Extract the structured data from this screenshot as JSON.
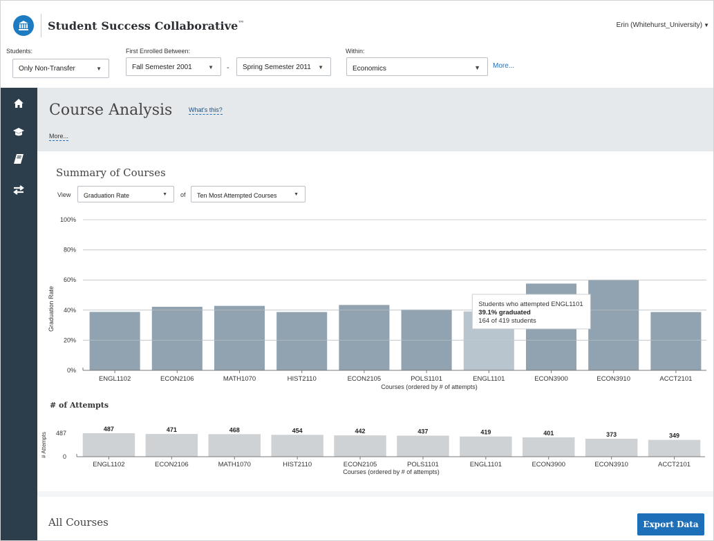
{
  "app": {
    "title": "Student Success Collaborative",
    "trademark": "™",
    "user": "Erin (Whitehurst_University)",
    "logo_icon": "university-building-icon"
  },
  "filters": {
    "students_label": "Students:",
    "students_value": "Only Non-Transfer",
    "enrolled_label": "First Enrolled Between:",
    "enrolled_from": "Fall Semester 2001",
    "enrolled_sep": "-",
    "enrolled_to": "Spring Semester 2011",
    "within_label": "Within:",
    "within_value": "Economics",
    "more_label": "More..."
  },
  "sidebar": {
    "items": [
      {
        "icon": "home-icon"
      },
      {
        "icon": "graduation-cap-icon"
      },
      {
        "icon": "book-icon"
      },
      {
        "icon": "transfer-arrows-icon"
      }
    ]
  },
  "page": {
    "title": "Course Analysis",
    "whats_this": "What's this?",
    "more": "More..."
  },
  "summary": {
    "title": "Summary of Courses",
    "view_label": "View",
    "view_value": "Graduation Rate",
    "of_label": "of",
    "of_value": "Ten Most Attempted Courses"
  },
  "chart_data": [
    {
      "type": "bar",
      "categories": [
        "ENGL1102",
        "ECON2106",
        "MATH1070",
        "HIST2110",
        "ECON2105",
        "POLS1101",
        "ENGL1101",
        "ECON3900",
        "ECON3910",
        "ACCT2101"
      ],
      "values": [
        38.8,
        42.2,
        42.8,
        38.7,
        43.4,
        40.3,
        39.1,
        57.6,
        60.0,
        38.7
      ],
      "ylabel": "Graduation Rate",
      "xlabel": "Courses (ordered by # of attempts)",
      "yticks": [
        "0%",
        "20%",
        "40%",
        "60%",
        "80%",
        "100%"
      ],
      "ylim": [
        0,
        100
      ],
      "grid": true,
      "highlight_index": 6,
      "tooltip": {
        "line1": "Students who attempted ENGL1101",
        "line2": "39.1% graduated",
        "line3": "164 of 419 students"
      },
      "colors": {
        "bar": "#91a3b0",
        "highlight": "#b8c5ce"
      }
    },
    {
      "type": "bar",
      "title": "# of Attempts",
      "categories": [
        "ENGL1102",
        "ECON2106",
        "MATH1070",
        "HIST2110",
        "ECON2105",
        "POLS1101",
        "ENGL1101",
        "ECON3900",
        "ECON3910",
        "ACCT2101"
      ],
      "values": [
        487,
        471,
        468,
        454,
        442,
        437,
        419,
        401,
        373,
        349
      ],
      "ylabel": "# Attempts",
      "xlabel": "Courses (ordered by # of attempts)",
      "yticks": [
        "0",
        "487"
      ],
      "ylim": [
        0,
        487
      ],
      "colors": {
        "bar": "#cfd2d4"
      }
    }
  ],
  "all_courses": {
    "title": "All Courses",
    "export_label": "Export Data"
  }
}
